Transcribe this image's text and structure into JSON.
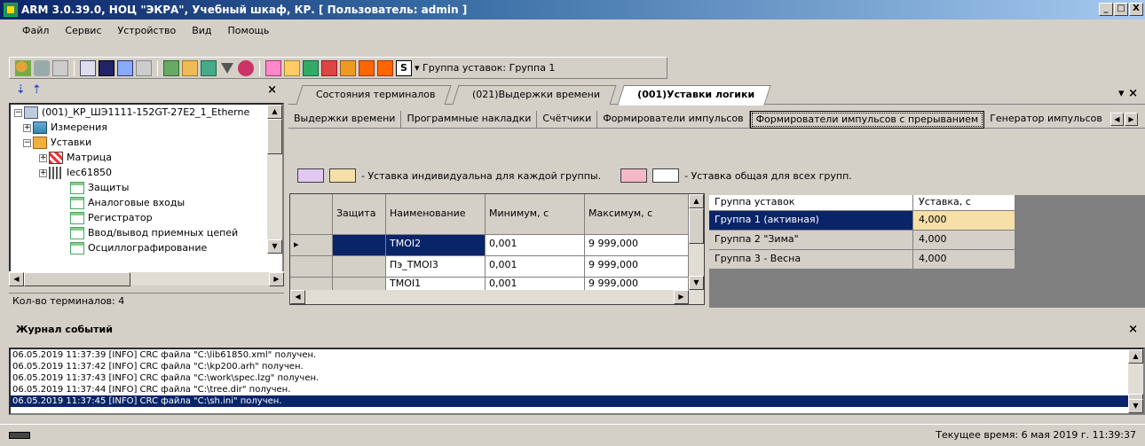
{
  "window": {
    "title": "ARM 3.0.39.0, НОЦ \"ЭКРА\", Учебный шкаф, КР. [ Пользователь: admin ]",
    "buttons": [
      "_",
      "□",
      "X"
    ]
  },
  "menu": [
    "Файл",
    "Сервис",
    "Устройство",
    "Вид",
    "Помощь"
  ],
  "toolbar": {
    "group_dropdown_icon": "S",
    "group_label": "▾ Группа уставок: Группа 1"
  },
  "left_panel": {
    "close": "×",
    "tree": [
      {
        "label": "(001)_КР_ШЭ1111-152GT-27E2_1_Etherne",
        "toggle": "−",
        "icon": "computer-icon"
      },
      {
        "label": "Измерения",
        "toggle": "+",
        "icon": "measurements-icon"
      },
      {
        "label": "Уставки",
        "toggle": "−",
        "icon": "folder-icon"
      },
      {
        "label": "Матрица",
        "toggle": "+",
        "icon": "matrix-icon"
      },
      {
        "label": "Iec61850",
        "toggle": "+",
        "icon": "iec-icon"
      },
      {
        "label": "Защиты",
        "toggle": "",
        "icon": "document-icon"
      },
      {
        "label": "Аналоговые входы",
        "toggle": "",
        "icon": "document-icon"
      },
      {
        "label": "Регистратор",
        "toggle": "",
        "icon": "document-icon"
      },
      {
        "label": "Ввод/вывод приемных цепей",
        "toggle": "",
        "icon": "document-icon"
      },
      {
        "label": "Осциллографирование",
        "toggle": "",
        "icon": "document-icon"
      }
    ],
    "count": "Кол-во терминалов: 4"
  },
  "doc_tabs": [
    "Состояния терминалов",
    "(021)Выдержки времени",
    "(001)Уставки логики"
  ],
  "doc_tabs_close": "▾ ×",
  "sub_tabs": [
    "Выдержки времени",
    "Программные накладки",
    "Счётчики",
    "Формирователи импульсов",
    "Формирователи импульсов с прерыванием",
    "Генератор импульсов"
  ],
  "legend": {
    "individual": "- Уставка индивидуальна для каждой группы.",
    "common": "- Уставка общая для всех групп.",
    "colors": {
      "ind1": "#e0c8f0",
      "ind2": "#f7dfa8",
      "com1": "#f4b8c8",
      "com2": "#ffffff"
    }
  },
  "settings_table": {
    "headers": [
      "Защита",
      "Наименование",
      "Минимум, с",
      "Максимум, с"
    ],
    "rows": [
      {
        "marker": "▸",
        "name": "TMOI2",
        "min": "0,001",
        "max": "9 999,000"
      },
      {
        "marker": "",
        "name": "Пэ_TMOI3",
        "min": "0,001",
        "max": "9 999,000"
      },
      {
        "marker": "",
        "name": "TMOI1",
        "min": "0,001",
        "max": "9 999,000"
      }
    ]
  },
  "groups_table": {
    "headers": [
      "Группа уставок",
      "Уставка, с"
    ],
    "rows": [
      {
        "group": "Группа 1 (активная)",
        "value": "4,000"
      },
      {
        "group": "Группа 2 \"Зима\"",
        "value": "4,000"
      },
      {
        "group": "Группа 3 - Весна",
        "value": "4,000"
      }
    ]
  },
  "events": {
    "title": "Журнал событий",
    "close": "×",
    "rows": [
      "06.05.2019 11:37:39 [INFO] CRC файла \"C:\\lib61850.xml\" получен.",
      "06.05.2019 11:37:42 [INFO] CRC файла \"C:\\kp200.arh\" получен.",
      "06.05.2019 11:37:43 [INFO] CRC файла \"C:\\work\\spec.lzg\" получен.",
      "06.05.2019 11:37:44 [INFO] CRC файла \"C:\\tree.dir\" получен.",
      "06.05.2019 11:37:45 [INFO] CRC файла \"C:\\sh.ini\" получен."
    ]
  },
  "status": {
    "time": "Текущее время: 6 мая 2019 г. 11:39:37"
  }
}
